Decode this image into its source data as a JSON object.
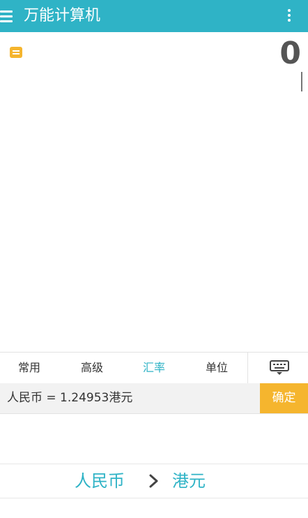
{
  "header": {
    "title": "万能计算机"
  },
  "display": {
    "value": "0"
  },
  "tabs": [
    {
      "label": "常用"
    },
    {
      "label": "高级"
    },
    {
      "label": "汇率"
    },
    {
      "label": "单位"
    }
  ],
  "active_tab": "汇率",
  "expression": {
    "text": "人民币 = 1.24953港元",
    "confirm_label": "确定"
  },
  "conversion": {
    "from": "人民币",
    "to": "港元"
  },
  "colors": {
    "primary": "#2fb3c6",
    "accent": "#f5b52e"
  },
  "icons": {
    "menu": "menu-icon",
    "more": "more-vertical-icon",
    "history": "history-icon",
    "keyboard": "keyboard-icon",
    "arrow": "chevron-right-icon"
  }
}
